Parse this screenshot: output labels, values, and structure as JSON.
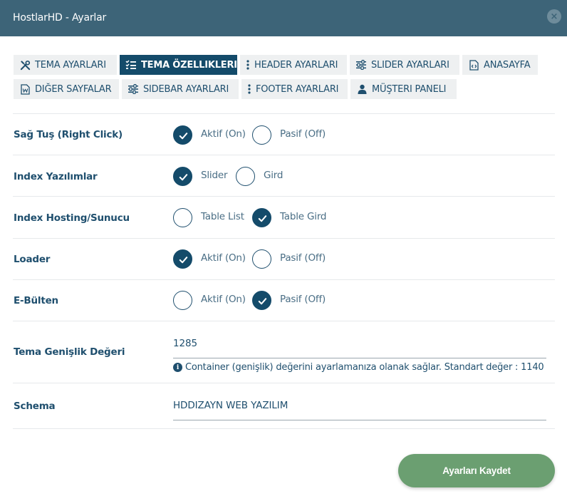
{
  "window": {
    "title": "HostlarHD - Ayarlar",
    "close_icon": "×"
  },
  "tabs": [
    {
      "label": "TEMA AYARLARI",
      "icon": "tools-icon",
      "active": false
    },
    {
      "label": "TEMA ÖZELLIKLERI",
      "icon": "list-check-icon",
      "active": true
    },
    {
      "label": "HEADER AYARLARI",
      "icon": "vertical-dots-icon",
      "active": false
    },
    {
      "label": "SLIDER AYARLARI",
      "icon": "sliders-icon",
      "active": false
    },
    {
      "label": "ANASAYFA",
      "icon": "code-file-icon",
      "active": false
    },
    {
      "label": "DIĞER SAYFALAR",
      "icon": "word-file-icon",
      "active": false
    },
    {
      "label": "SIDEBAR AYARLARI",
      "icon": "sliders-icon",
      "active": false
    },
    {
      "label": "FOOTER AYARLARI",
      "icon": "vertical-dots-icon",
      "active": false
    },
    {
      "label": "MÜŞTERI PANELI",
      "icon": "user-icon",
      "active": false
    }
  ],
  "settings": {
    "right_click": {
      "label": "Sağ Tuş (Right Click)",
      "option1": "Aktif (On)",
      "option2": "Pasif (Off)",
      "selected": 1
    },
    "index_posts": {
      "label": "Index Yazılımlar",
      "option1": "Slider",
      "option2": "Gird",
      "selected": 1
    },
    "index_hosting": {
      "label": "Index Hosting/Sunucu",
      "option1": "Table List",
      "option2": "Table Gird",
      "selected": 2
    },
    "loader": {
      "label": "Loader",
      "option1": "Aktif (On)",
      "option2": "Pasif (Off)",
      "selected": 1
    },
    "newsletter": {
      "label": "E-Bülten",
      "option1": "Aktif (On)",
      "option2": "Pasif (Off)",
      "selected": 2
    }
  },
  "theme_width": {
    "label": "Tema Genişlik Değeri",
    "value": "1285",
    "help_icon": "info-icon",
    "help": "Container (genişlik) değerini ayarlamanıza olanak sağlar. Standart değer : 1140"
  },
  "schema": {
    "label": "Schema",
    "value": "HDDIZAYN WEB YAZILIM"
  },
  "save_button": "Ayarları Kaydet",
  "colors": {
    "header": "#3d6478",
    "active_tab": "#144b6a",
    "accent": "#144b6a",
    "save": "#6b9f71"
  }
}
